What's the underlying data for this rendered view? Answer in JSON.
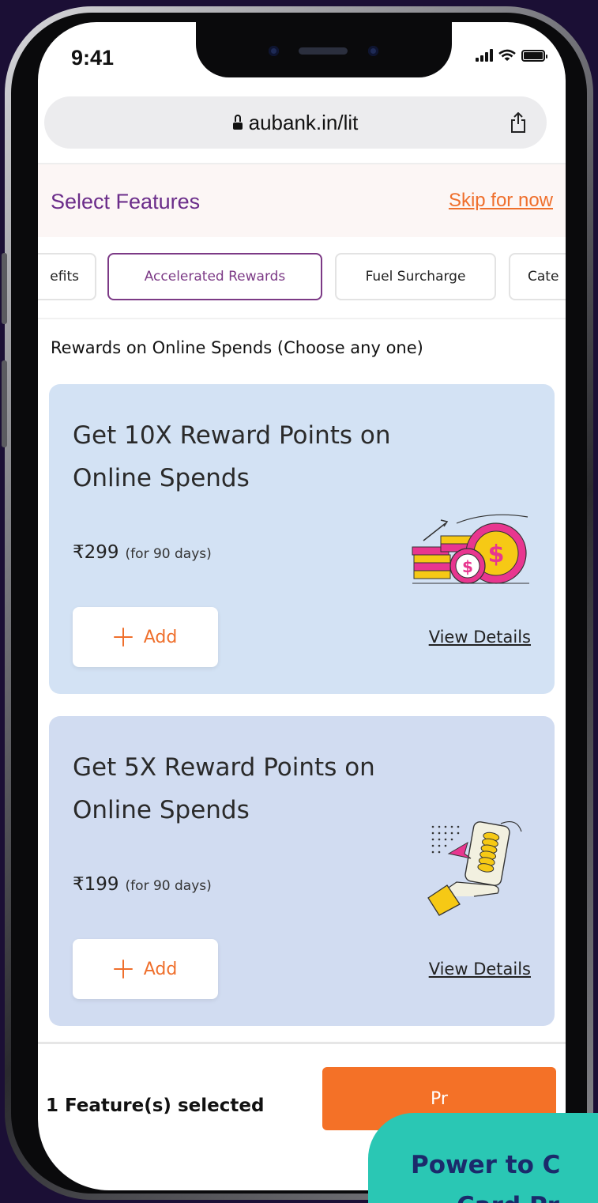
{
  "status_bar": {
    "time": "9:41"
  },
  "browser": {
    "url": "aubank.in/lit"
  },
  "header": {
    "title": "Select Features",
    "skip_label": "Skip for now"
  },
  "tabs": [
    {
      "label": "efits",
      "active": false
    },
    {
      "label": "Accelerated Rewards",
      "active": true
    },
    {
      "label": "Fuel Surcharge",
      "active": false
    },
    {
      "label": "Cate",
      "active": false
    }
  ],
  "section": {
    "label": "Rewards on Online Spends (Choose any one)"
  },
  "cards": [
    {
      "title": "Get 10X Reward Points on Online Spends",
      "price": "₹299",
      "period": "(for 90 days)",
      "add_label": "Add",
      "details_label": "View Details",
      "bg_color": "#d3e2f4",
      "illustration": "coins-growth-icon"
    },
    {
      "title": "Get 5X Reward Points on Online Spends",
      "price": "₹199",
      "period": "(for 90 days)",
      "add_label": "Add",
      "details_label": "View Details",
      "bg_color": "#d1dcf1",
      "illustration": "phone-coins-hand-icon"
    }
  ],
  "footer": {
    "selected_text": "1 Feature(s) selected",
    "proceed_label": "Pr"
  },
  "promo": {
    "line1": "Power to C",
    "line2": "Card Pr"
  },
  "colors": {
    "background": "#1b0f35",
    "brand_purple": "#6b2d8a",
    "accent_orange": "#ef6f2c",
    "promo_teal": "#2ac7b4",
    "promo_text": "#1b2a6b"
  }
}
